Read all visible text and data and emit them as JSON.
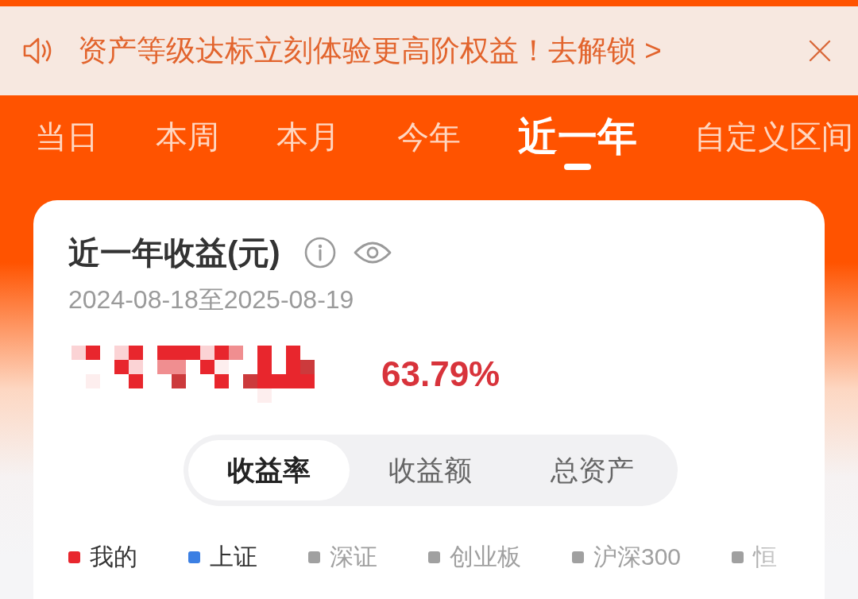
{
  "notice": {
    "text": "资产等级达标立刻体验更高阶权益！去解锁 >"
  },
  "period_tabs": [
    {
      "label": "当日",
      "selected": false
    },
    {
      "label": "本周",
      "selected": false
    },
    {
      "label": "本月",
      "selected": false
    },
    {
      "label": "今年",
      "selected": false
    },
    {
      "label": "近一年",
      "selected": true
    },
    {
      "label": "自定义区间",
      "selected": false
    }
  ],
  "summary": {
    "title": "近一年收益(元)",
    "date_range": "2024-08-18至2025-08-19",
    "return_rate": "63.79%"
  },
  "view_segments": [
    {
      "label": "收益率",
      "selected": true
    },
    {
      "label": "收益额",
      "selected": false
    },
    {
      "label": "总资产",
      "selected": false
    }
  ],
  "legend": [
    {
      "label": "我的",
      "color": "#e8262d",
      "on": true
    },
    {
      "label": "上证",
      "color": "#3b7fe3",
      "on": true
    },
    {
      "label": "深证",
      "color": "#a0a0a0",
      "on": false
    },
    {
      "label": "创业板",
      "color": "#a0a0a0",
      "on": false
    },
    {
      "label": "沪深300",
      "color": "#a0a0a0",
      "on": false
    },
    {
      "label": "恒",
      "color": "#a0a0a0",
      "on": false
    }
  ]
}
